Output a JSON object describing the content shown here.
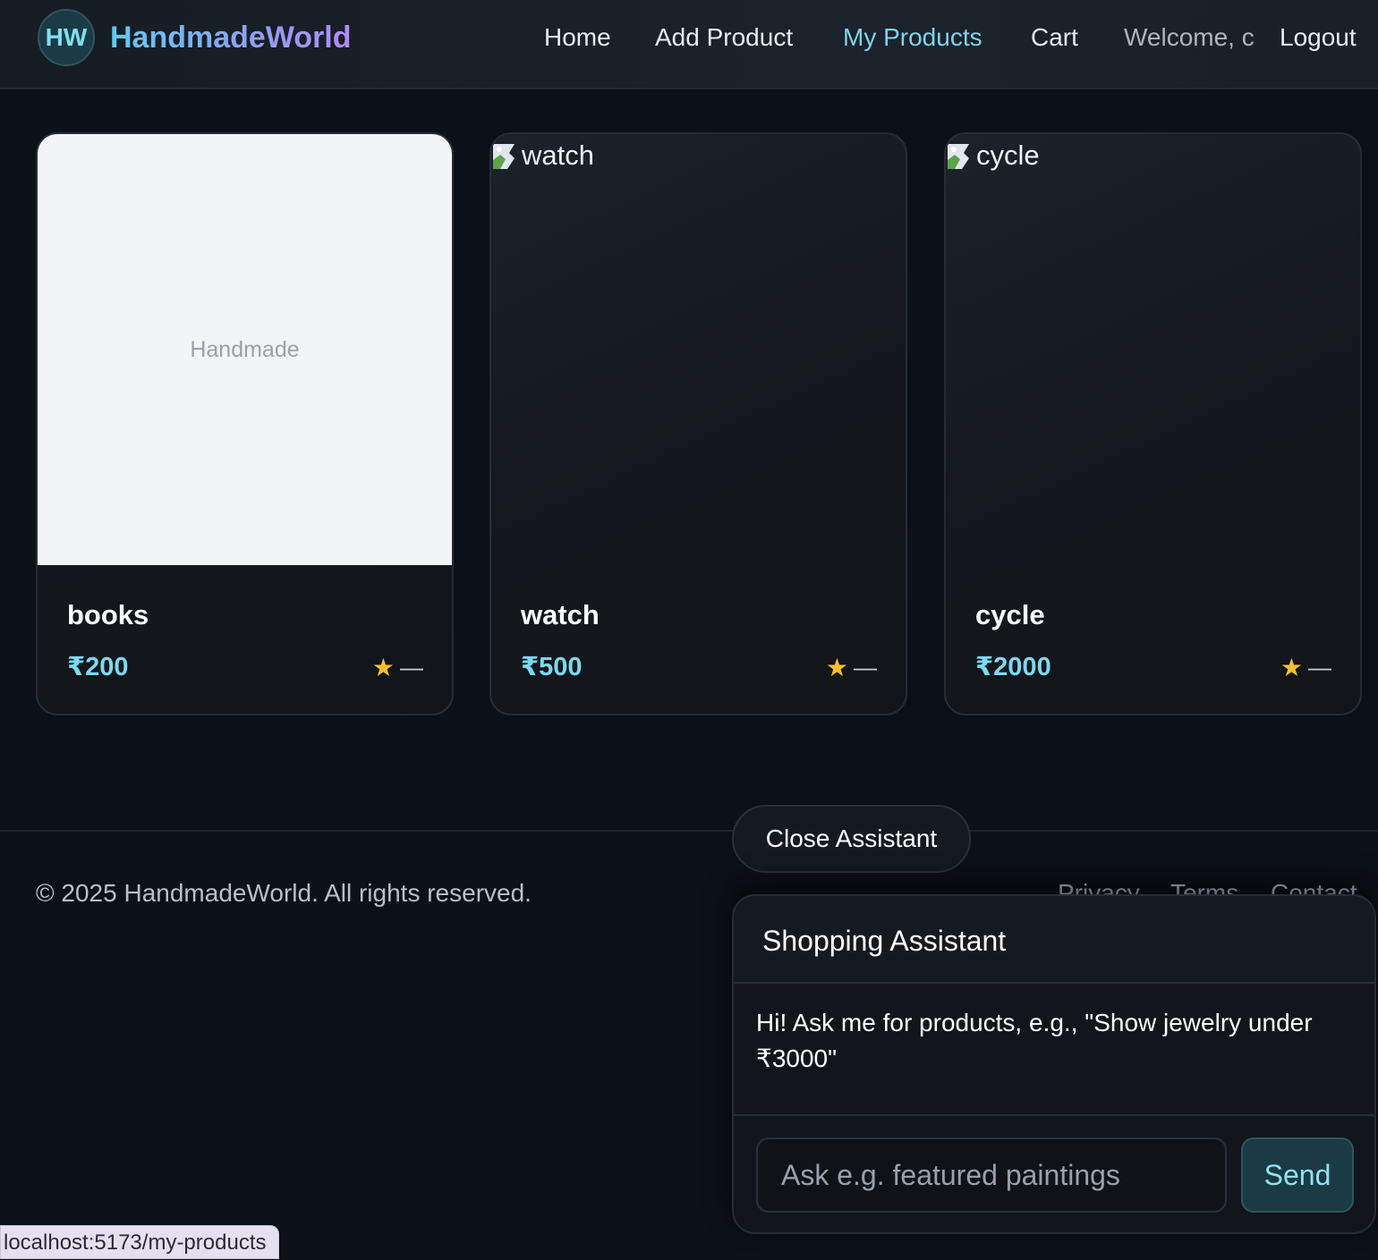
{
  "header": {
    "logo_initials": "HW",
    "brand": "HandmadeWorld",
    "nav": {
      "home": "Home",
      "add_product": "Add Product",
      "my_products": "My Products",
      "cart": "Cart",
      "welcome": "Welcome, c",
      "logout": "Logout"
    }
  },
  "products": [
    {
      "name": "books",
      "price": "₹200",
      "image_placeholder": "Handmade",
      "rating": "—"
    },
    {
      "name": "watch",
      "price": "₹500",
      "image_alt": "watch",
      "rating": "—"
    },
    {
      "name": "cycle",
      "price": "₹2000",
      "image_alt": "cycle",
      "rating": "—"
    }
  ],
  "footer": {
    "copyright": "© 2025 HandmadeWorld. All rights reserved.",
    "links": [
      "Privacy",
      "Terms",
      "Contact"
    ]
  },
  "assistant": {
    "toggle_label": "Close Assistant",
    "title": "Shopping Assistant",
    "message": "Hi! Ask me for products, e.g., \"Show jewelry under ₹3000\"",
    "input_placeholder": "Ask e.g. featured paintings",
    "send_label": "Send"
  },
  "status_bar": {
    "url": "localhost:5173/my-products"
  },
  "colors": {
    "background": "#0c1017",
    "accent": "#7ed8f0",
    "star": "#f6c12c"
  }
}
